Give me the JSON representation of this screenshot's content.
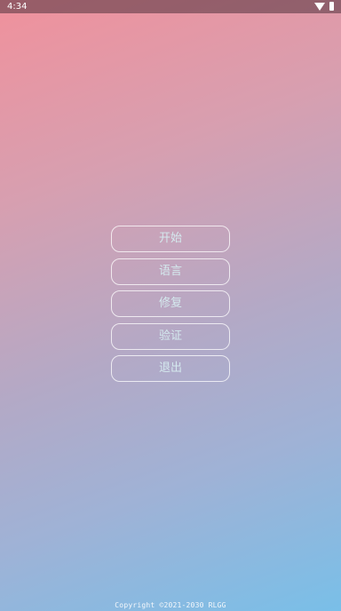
{
  "status_bar": {
    "time": "4:34",
    "icons": [
      "wifi-icon",
      "battery-icon"
    ]
  },
  "menu": {
    "items": [
      {
        "label": "开始"
      },
      {
        "label": "语言"
      },
      {
        "label": "修复"
      },
      {
        "label": "验证"
      },
      {
        "label": "退出"
      }
    ]
  },
  "footer": {
    "copyright": "Copyright ©2021-2030 RLGG"
  },
  "colors": {
    "gradient_top": "#f0919c",
    "gradient_bottom": "#79bfe8",
    "button_text": "#d4e9ee",
    "button_border": "#ffffff"
  }
}
